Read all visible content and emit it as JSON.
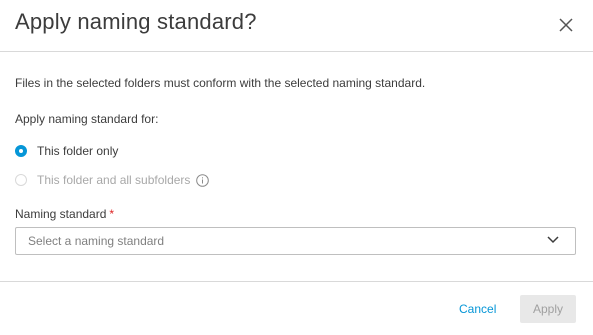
{
  "dialog": {
    "title": "Apply naming standard?",
    "description": "Files in the selected folders must conform with the selected naming standard.",
    "apply_for_label": "Apply naming standard for:",
    "options": [
      {
        "label": "This folder only",
        "selected": true,
        "disabled": false
      },
      {
        "label": "This folder and all subfolders",
        "selected": false,
        "disabled": true
      }
    ],
    "naming_standard_label": "Naming standard",
    "required_marker": "*",
    "select_placeholder": "Select a naming standard",
    "cancel_label": "Cancel",
    "apply_label": "Apply"
  },
  "icons": {
    "close": "close-icon",
    "info": "info-icon",
    "chevron": "chevron-down-icon"
  },
  "colors": {
    "accent": "#0696d7",
    "required": "#dd2222",
    "disabled_text": "#a8a8a8",
    "disabled_button_bg": "#e8e8e8"
  }
}
